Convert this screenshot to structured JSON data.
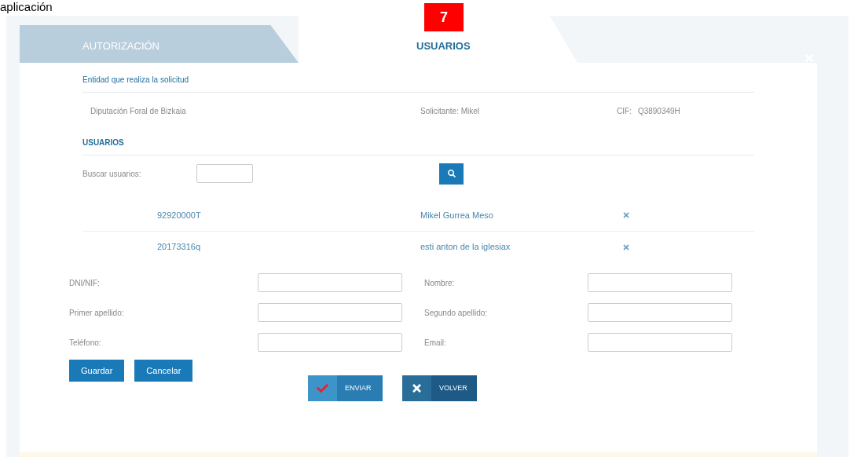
{
  "caption": "aplicación",
  "tabs": [
    {
      "label": "AUTORIZACIÓN",
      "selected": false
    },
    {
      "label": "USUARIOS",
      "selected": true
    }
  ],
  "badge": "7",
  "entity": {
    "heading": "Entidad que realiza la solicitud",
    "name": "Diputación Foral de Bizkaia",
    "requester_label": "Solicitante:",
    "requester": "Mikel",
    "cif_label": "CIF:",
    "cif": "Q3890349H"
  },
  "users": {
    "heading": "USUARIOS",
    "search_label": "Buscar usuarios:",
    "rows": [
      {
        "id": "92920000T",
        "name": "Mikel Gurrea Meso"
      },
      {
        "id": "20173316q",
        "name": "esti anton de la iglesiax"
      }
    ]
  },
  "form": [
    {
      "label": "DNI/NIF:"
    },
    {
      "label": "Nombre:"
    },
    {
      "label": "Primer apellido:"
    },
    {
      "label": "Segundo apellido:"
    },
    {
      "label": "Teléfono:"
    },
    {
      "label": "Email:"
    }
  ],
  "form_buttons": [
    "Guardar",
    "Cancelar"
  ],
  "actions": [
    {
      "kind": "send",
      "label": "ENVIAR"
    },
    {
      "kind": "back",
      "label": "VOLVER"
    }
  ]
}
